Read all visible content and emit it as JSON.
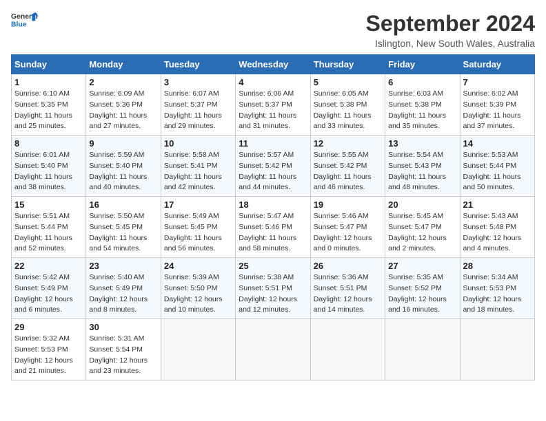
{
  "header": {
    "logo_line1": "General",
    "logo_line2": "Blue",
    "month_title": "September 2024",
    "location": "Islington, New South Wales, Australia"
  },
  "calendar": {
    "weekdays": [
      "Sunday",
      "Monday",
      "Tuesday",
      "Wednesday",
      "Thursday",
      "Friday",
      "Saturday"
    ],
    "weeks": [
      [
        null,
        {
          "day": 2,
          "sunrise": "6:09 AM",
          "sunset": "5:36 PM",
          "daylight": "11 hours and 27 minutes."
        },
        {
          "day": 3,
          "sunrise": "6:07 AM",
          "sunset": "5:37 PM",
          "daylight": "11 hours and 29 minutes."
        },
        {
          "day": 4,
          "sunrise": "6:06 AM",
          "sunset": "5:37 PM",
          "daylight": "11 hours and 31 minutes."
        },
        {
          "day": 5,
          "sunrise": "6:05 AM",
          "sunset": "5:38 PM",
          "daylight": "11 hours and 33 minutes."
        },
        {
          "day": 6,
          "sunrise": "6:03 AM",
          "sunset": "5:38 PM",
          "daylight": "11 hours and 35 minutes."
        },
        {
          "day": 7,
          "sunrise": "6:02 AM",
          "sunset": "5:39 PM",
          "daylight": "11 hours and 37 minutes."
        }
      ],
      [
        {
          "day": 1,
          "sunrise": "6:10 AM",
          "sunset": "5:35 PM",
          "daylight": "11 hours and 25 minutes."
        },
        {
          "day": 8,
          "sunrise": "6:01 AM",
          "sunset": "5:40 PM",
          "daylight": "11 hours and 38 minutes."
        },
        {
          "day": 9,
          "sunrise": "5:59 AM",
          "sunset": "5:40 PM",
          "daylight": "11 hours and 40 minutes."
        },
        {
          "day": 10,
          "sunrise": "5:58 AM",
          "sunset": "5:41 PM",
          "daylight": "11 hours and 42 minutes."
        },
        {
          "day": 11,
          "sunrise": "5:57 AM",
          "sunset": "5:42 PM",
          "daylight": "11 hours and 44 minutes."
        },
        {
          "day": 12,
          "sunrise": "5:55 AM",
          "sunset": "5:42 PM",
          "daylight": "11 hours and 46 minutes."
        },
        {
          "day": 13,
          "sunrise": "5:54 AM",
          "sunset": "5:43 PM",
          "daylight": "11 hours and 48 minutes."
        },
        {
          "day": 14,
          "sunrise": "5:53 AM",
          "sunset": "5:44 PM",
          "daylight": "11 hours and 50 minutes."
        }
      ],
      [
        {
          "day": 15,
          "sunrise": "5:51 AM",
          "sunset": "5:44 PM",
          "daylight": "11 hours and 52 minutes."
        },
        {
          "day": 16,
          "sunrise": "5:50 AM",
          "sunset": "5:45 PM",
          "daylight": "11 hours and 54 minutes."
        },
        {
          "day": 17,
          "sunrise": "5:49 AM",
          "sunset": "5:45 PM",
          "daylight": "11 hours and 56 minutes."
        },
        {
          "day": 18,
          "sunrise": "5:47 AM",
          "sunset": "5:46 PM",
          "daylight": "11 hours and 58 minutes."
        },
        {
          "day": 19,
          "sunrise": "5:46 AM",
          "sunset": "5:47 PM",
          "daylight": "12 hours and 0 minutes."
        },
        {
          "day": 20,
          "sunrise": "5:45 AM",
          "sunset": "5:47 PM",
          "daylight": "12 hours and 2 minutes."
        },
        {
          "day": 21,
          "sunrise": "5:43 AM",
          "sunset": "5:48 PM",
          "daylight": "12 hours and 4 minutes."
        }
      ],
      [
        {
          "day": 22,
          "sunrise": "5:42 AM",
          "sunset": "5:49 PM",
          "daylight": "12 hours and 6 minutes."
        },
        {
          "day": 23,
          "sunrise": "5:40 AM",
          "sunset": "5:49 PM",
          "daylight": "12 hours and 8 minutes."
        },
        {
          "day": 24,
          "sunrise": "5:39 AM",
          "sunset": "5:50 PM",
          "daylight": "12 hours and 10 minutes."
        },
        {
          "day": 25,
          "sunrise": "5:38 AM",
          "sunset": "5:51 PM",
          "daylight": "12 hours and 12 minutes."
        },
        {
          "day": 26,
          "sunrise": "5:36 AM",
          "sunset": "5:51 PM",
          "daylight": "12 hours and 14 minutes."
        },
        {
          "day": 27,
          "sunrise": "5:35 AM",
          "sunset": "5:52 PM",
          "daylight": "12 hours and 16 minutes."
        },
        {
          "day": 28,
          "sunrise": "5:34 AM",
          "sunset": "5:53 PM",
          "daylight": "12 hours and 18 minutes."
        }
      ],
      [
        {
          "day": 29,
          "sunrise": "5:32 AM",
          "sunset": "5:53 PM",
          "daylight": "12 hours and 21 minutes."
        },
        {
          "day": 30,
          "sunrise": "5:31 AM",
          "sunset": "5:54 PM",
          "daylight": "12 hours and 23 minutes."
        },
        null,
        null,
        null,
        null,
        null
      ]
    ]
  }
}
